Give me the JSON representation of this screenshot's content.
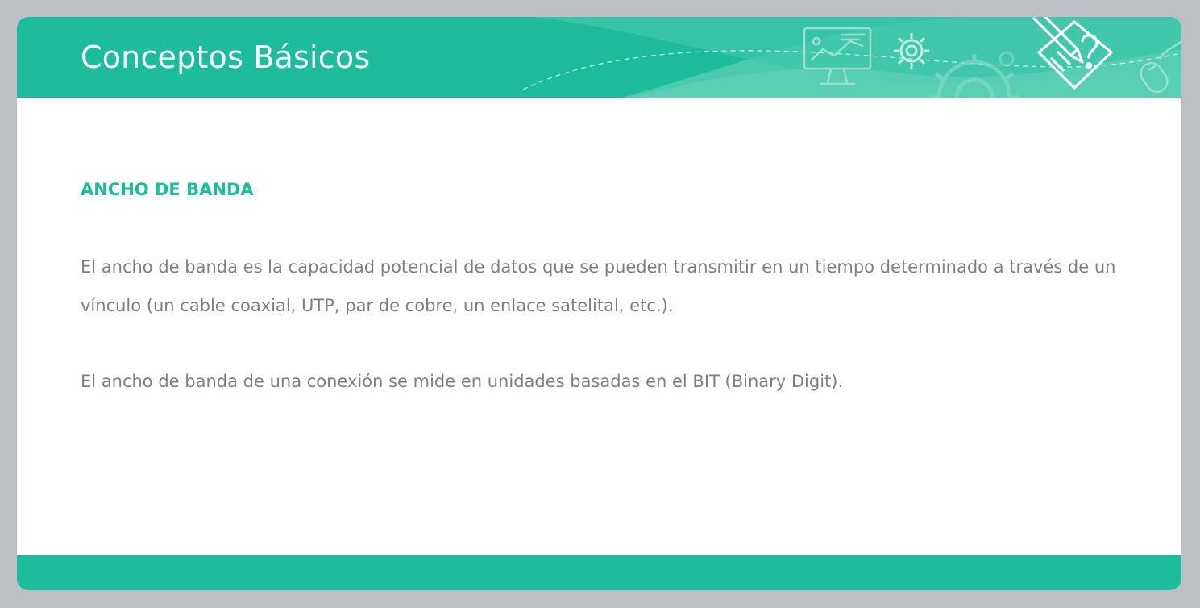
{
  "slide": {
    "title": "Conceptos Básicos",
    "section_heading": "ANCHO DE BANDA",
    "paragraphs": [
      "El ancho de banda es la capacidad potencial de datos que se pueden transmitir en un tiempo determinado a través de un vínculo (un cable coaxial, UTP, par de cobre, un enlace satelital, etc.).",
      "El ancho de banda de una conexión se mide en unidades basadas en el BIT (Binary Digit)."
    ]
  },
  "decor_icons": [
    "monitor-chart-icon",
    "gear-icon",
    "large-gear-icon",
    "pencil-question-icon",
    "mouse-icon"
  ],
  "colors": {
    "accent": "#1dbc9b",
    "body_text": "#7f7f7f",
    "background": "#bcc0c4",
    "slide": "#ffffff"
  }
}
